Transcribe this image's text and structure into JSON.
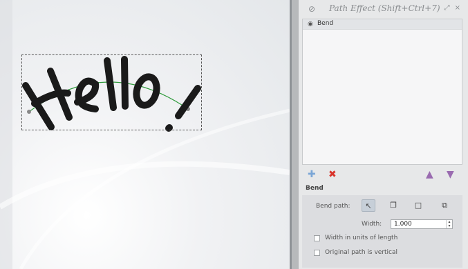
{
  "canvas": {
    "art_text": "Hello!"
  },
  "panel": {
    "title": "Path Effect (Shift+Ctrl+7)",
    "title_buttons": "⤢ ×",
    "effects": [
      {
        "label": "Bend"
      }
    ],
    "section_title": "Bend",
    "bend_path_label": "Bend path:",
    "width_label": "Width:",
    "width_value": "1.000",
    "width_units_label": "Width in units of length",
    "vertical_label": "Original path is vertical"
  },
  "colors": {
    "path_stroke": "#1a1a1a",
    "bend_guide": "#2e9a3a",
    "accent_purple": "#9a6bb0",
    "delete_red": "#d9342b",
    "add_blue": "#7aa6d6"
  }
}
